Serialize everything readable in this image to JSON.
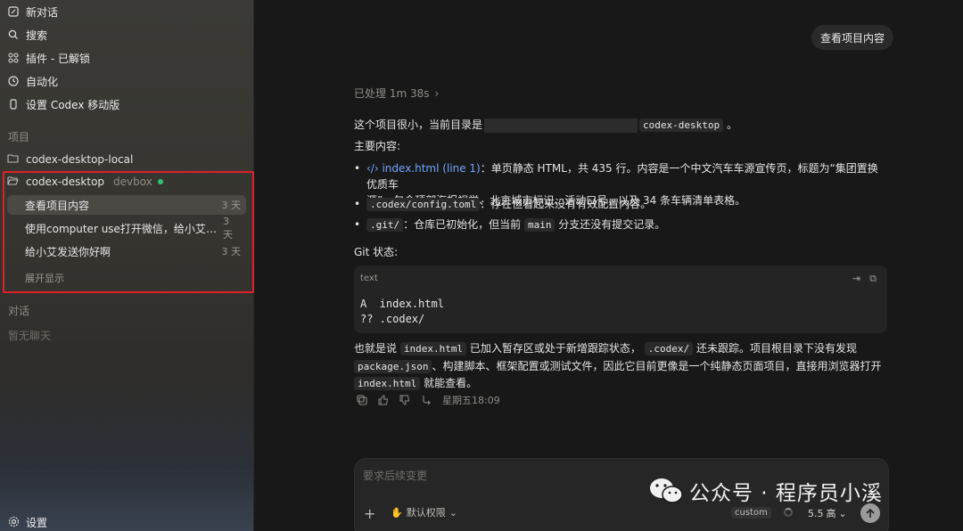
{
  "sidebar": {
    "nav": [
      {
        "label": "新对话",
        "icon": "compose-icon"
      },
      {
        "label": "搜索",
        "icon": "search-icon"
      },
      {
        "label": "插件 - 已解锁",
        "icon": "plugins-icon"
      },
      {
        "label": "自动化",
        "icon": "clock-icon"
      },
      {
        "label": "设置 Codex 移动版",
        "icon": "phone-icon"
      }
    ],
    "projects_label": "项目",
    "projects": [
      {
        "name": "codex-desktop-local"
      },
      {
        "name": "codex-desktop",
        "tag": "devbox",
        "status_color": "#31c36b"
      }
    ],
    "threads": [
      {
        "title": "查看项目内容",
        "age": "3 天",
        "active": true
      },
      {
        "title": "使用computer use打开微信，给小艾发送你好啊",
        "age": "3 天"
      },
      {
        "title": "给小艾发送你好啊",
        "age": "3 天"
      }
    ],
    "expand_label": "展开显示",
    "chats_label": "对话",
    "no_chats": "暂无聊天",
    "settings_label": "设置"
  },
  "main": {
    "user_message": "查看项目内容",
    "processed": "已处理 1m 38s",
    "intro_prefix": "这个项目很小，当前目录是",
    "intro_dir": "codex-desktop",
    "intro_suffix": "。",
    "content_heading": "主要内容:",
    "bullets": [
      {
        "link": "index.html (line 1)",
        "text_line1": "：单页静态 HTML，共 435 行。内容是一个中文汽车车源宣传页，标题为“集团置换优质车",
        "text_line2": "源”，包含顶部海报视觉、北京城市标识、活动口号，以及 34 条车辆清单表格。"
      },
      {
        "code": ".codex/config.toml",
        "text": "：存在但看起来没有有效配置内容。"
      },
      {
        "code": ".git/",
        "text_a": "：仓库已初始化，但当前",
        "code2": "main",
        "text_b": "分支还没有提交记录。"
      }
    ],
    "git_heading": "Git 状态:",
    "code_lang": "text",
    "code_line1": "A  index.html",
    "code_line2": "?? .codex/",
    "summary": {
      "p1": "也就是说",
      "c1": "index.html",
      "p2": "已加入暂存区或处于新增跟踪状态，",
      "c2": ".codex/",
      "p3": "还未跟踪。项目根目录下没有发现",
      "c3": "package.json",
      "p4": "、构建脚本、框架配置或测试文件，因此它目前更像是一个纯静态页面项目，直接用浏览器打开",
      "c4": "index.html",
      "p5": "就能查看。"
    },
    "timestamp": "星期五18:09"
  },
  "composer": {
    "placeholder": "要求后续变更",
    "permission": "默认权限",
    "custom": "custom",
    "model": "5.5",
    "effort": "高"
  },
  "watermark": {
    "text": "公众号 · 程序员小溪"
  },
  "colors": {
    "highlight_border": "#e0202a",
    "link": "#6fa6ff"
  }
}
